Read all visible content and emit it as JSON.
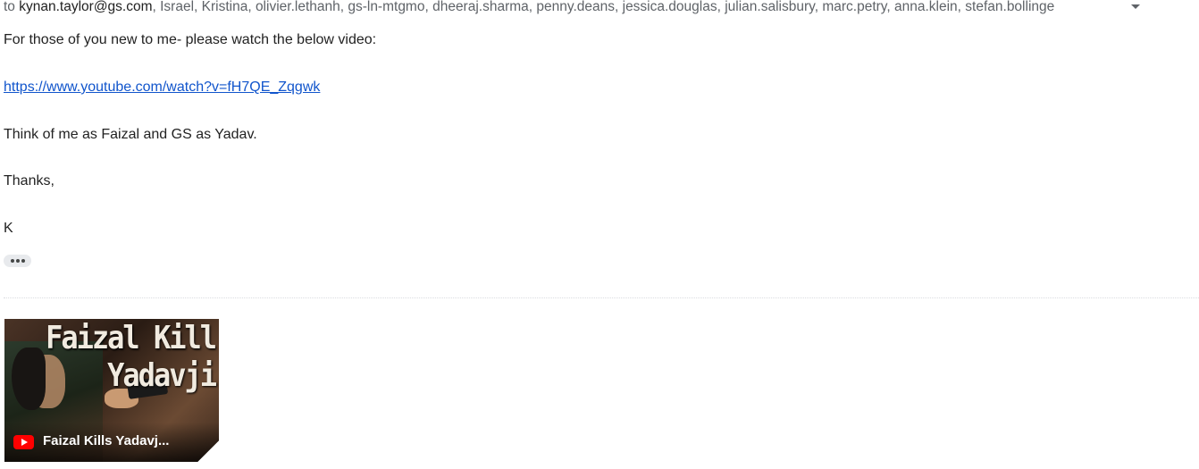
{
  "recipients": {
    "to_label": "to",
    "primary": "kynan.taylor@gs.com",
    "others": ", Israel, Kristina, olivier.lethanh, gs-ln-mtgmo, dheeraj.sharma, penny.deans, jessica.douglas, julian.salisbury, marc.petry, anna.klein, stefan.bollinge",
    "expand_icon": "caret-down-icon"
  },
  "body": {
    "line1": "For those of you new to me- please watch the below video:",
    "link": "https://www.youtube.com/watch?v=fH7QE_Zqgwk",
    "line2": "Think of me as Faizal and GS as Yadav.",
    "signoff": "Thanks,",
    "signature": "K"
  },
  "attachment": {
    "thumbnail_text": [
      "Faizal Kill",
      "Yadavji"
    ],
    "caption": "Faizal Kills Yadavj...",
    "source_icon": "youtube-icon"
  },
  "colors": {
    "link": "#1155cc",
    "text": "#222222",
    "muted": "#5f6368"
  }
}
